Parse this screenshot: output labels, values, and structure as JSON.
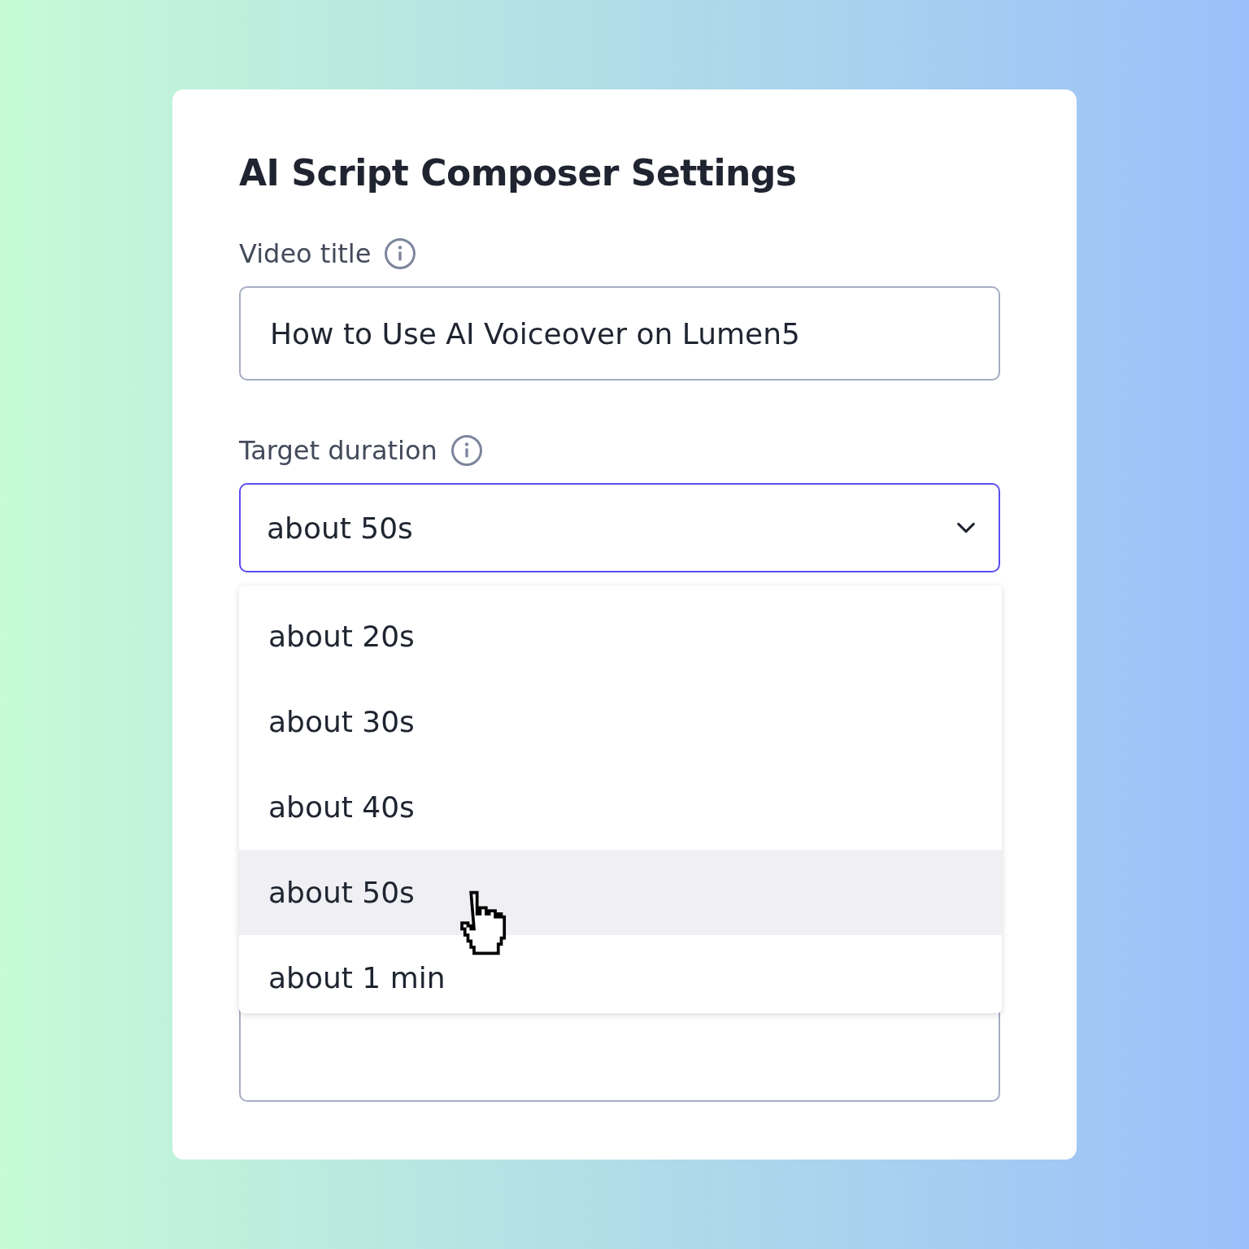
{
  "dialog": {
    "title": "AI Script Composer Settings"
  },
  "video_title": {
    "label": "Video title",
    "value": "How to Use AI Voiceover on Lumen5"
  },
  "target_duration": {
    "label": "Target duration",
    "value": "about 50s",
    "expanded": true,
    "options": [
      {
        "label": "about 20s",
        "selected": false
      },
      {
        "label": "about 30s",
        "selected": false
      },
      {
        "label": "about 40s",
        "selected": false
      },
      {
        "label": "about 50s",
        "selected": true
      },
      {
        "label": "about 1 min",
        "selected": false
      }
    ]
  }
}
